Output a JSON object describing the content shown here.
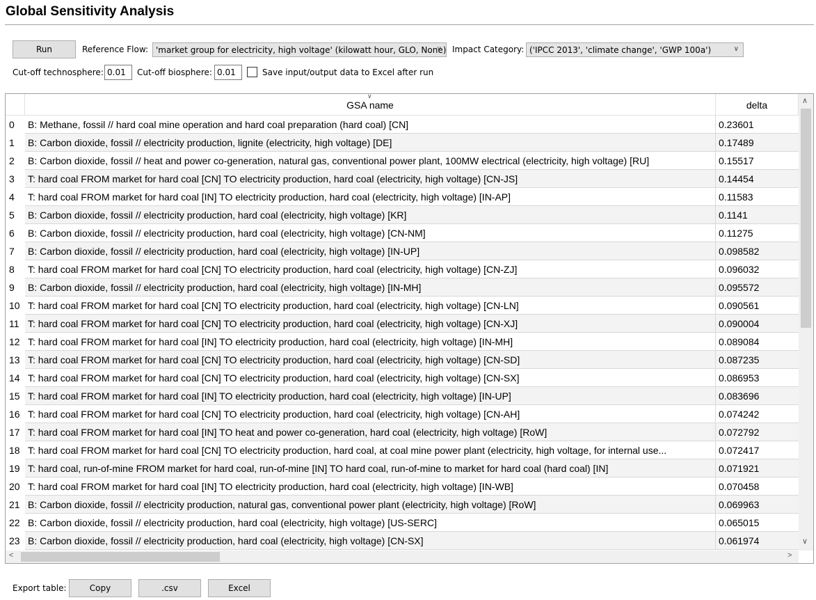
{
  "title": "Global Sensitivity Analysis",
  "controls": {
    "run_label": "Run",
    "reference_flow_label": "Reference Flow:",
    "reference_flow_value": "'market group for electricity, high voltage' (kilowatt hour, GLO, None)",
    "impact_category_label": "Impact Category:",
    "impact_category_value": "('IPCC 2013', 'climate change', 'GWP 100a')",
    "cutoff_techno_label": "Cut-off technosphere:",
    "cutoff_techno_value": "0.01",
    "cutoff_bio_label": "Cut-off biosphere:",
    "cutoff_bio_value": "0.01",
    "save_excel_label": "Save input/output data to Excel after run",
    "save_excel_checked": false
  },
  "table": {
    "columns": [
      "GSA name",
      "delta"
    ],
    "sorted_column": "GSA name",
    "rows": [
      [
        "0",
        "B: Methane, fossil // hard coal mine operation and hard coal preparation (hard coal) [CN]",
        "0.23601"
      ],
      [
        "1",
        "B: Carbon dioxide, fossil // electricity production, lignite (electricity, high voltage) [DE]",
        "0.17489"
      ],
      [
        "2",
        "B: Carbon dioxide, fossil // heat and power co-generation, natural gas, conventional power plant, 100MW electrical (electricity, high voltage) [RU]",
        "0.15517"
      ],
      [
        "3",
        "T: hard coal FROM market for hard coal [CN] TO electricity production, hard coal (electricity, high voltage) [CN-JS]",
        "0.14454"
      ],
      [
        "4",
        "T: hard coal FROM market for hard coal [IN] TO electricity production, hard coal (electricity, high voltage) [IN-AP]",
        "0.11583"
      ],
      [
        "5",
        "B: Carbon dioxide, fossil // electricity production, hard coal (electricity, high voltage) [KR]",
        "0.1141"
      ],
      [
        "6",
        "B: Carbon dioxide, fossil // electricity production, hard coal (electricity, high voltage) [CN-NM]",
        "0.11275"
      ],
      [
        "7",
        "B: Carbon dioxide, fossil // electricity production, hard coal (electricity, high voltage) [IN-UP]",
        "0.098582"
      ],
      [
        "8",
        "T: hard coal FROM market for hard coal [CN] TO electricity production, hard coal (electricity, high voltage) [CN-ZJ]",
        "0.096032"
      ],
      [
        "9",
        "B: Carbon dioxide, fossil // electricity production, hard coal (electricity, high voltage) [IN-MH]",
        "0.095572"
      ],
      [
        "10",
        "T: hard coal FROM market for hard coal [CN] TO electricity production, hard coal (electricity, high voltage) [CN-LN]",
        "0.090561"
      ],
      [
        "11",
        "T: hard coal FROM market for hard coal [CN] TO electricity production, hard coal (electricity, high voltage) [CN-XJ]",
        "0.090004"
      ],
      [
        "12",
        "T: hard coal FROM market for hard coal [IN] TO electricity production, hard coal (electricity, high voltage) [IN-MH]",
        "0.089084"
      ],
      [
        "13",
        "T: hard coal FROM market for hard coal [CN] TO electricity production, hard coal (electricity, high voltage) [CN-SD]",
        "0.087235"
      ],
      [
        "14",
        "T: hard coal FROM market for hard coal [CN] TO electricity production, hard coal (electricity, high voltage) [CN-SX]",
        "0.086953"
      ],
      [
        "15",
        "T: hard coal FROM market for hard coal [IN] TO electricity production, hard coal (electricity, high voltage) [IN-UP]",
        "0.083696"
      ],
      [
        "16",
        "T: hard coal FROM market for hard coal [CN] TO electricity production, hard coal (electricity, high voltage) [CN-AH]",
        "0.074242"
      ],
      [
        "17",
        "T: hard coal FROM market for hard coal [IN] TO heat and power co-generation, hard coal (electricity, high voltage) [RoW]",
        "0.072792"
      ],
      [
        "18",
        "T: hard coal FROM market for hard coal [CN] TO electricity production, hard coal, at coal mine power plant (electricity, high voltage, for internal use...",
        "0.072417"
      ],
      [
        "19",
        "T: hard coal, run-of-mine FROM market for hard coal, run-of-mine [IN] TO hard coal, run-of-mine to market for hard coal (hard coal) [IN]",
        "0.071921"
      ],
      [
        "20",
        "T: hard coal FROM market for hard coal [IN] TO electricity production, hard coal (electricity, high voltage) [IN-WB]",
        "0.070458"
      ],
      [
        "21",
        "B: Carbon dioxide, fossil // electricity production, natural gas, conventional power plant (electricity, high voltage) [RoW]",
        "0.069963"
      ],
      [
        "22",
        "B: Carbon dioxide, fossil // electricity production, hard coal (electricity, high voltage) [US-SERC]",
        "0.065015"
      ],
      [
        "23",
        "B: Carbon dioxide, fossil // electricity production, hard coal (electricity, high voltage) [CN-SX]",
        "0.061974"
      ]
    ]
  },
  "export": {
    "label": "Export table:",
    "copy_label": "Copy",
    "csv_label": ".csv",
    "excel_label": "Excel"
  },
  "icons": {
    "dropdown": "chevron-down-icon",
    "sort": "sort-indicator-icon",
    "scroll_up": "chevron-up-icon",
    "scroll_down": "chevron-down-icon",
    "scroll_left": "chevron-left-icon",
    "scroll_right": "chevron-right-icon"
  }
}
